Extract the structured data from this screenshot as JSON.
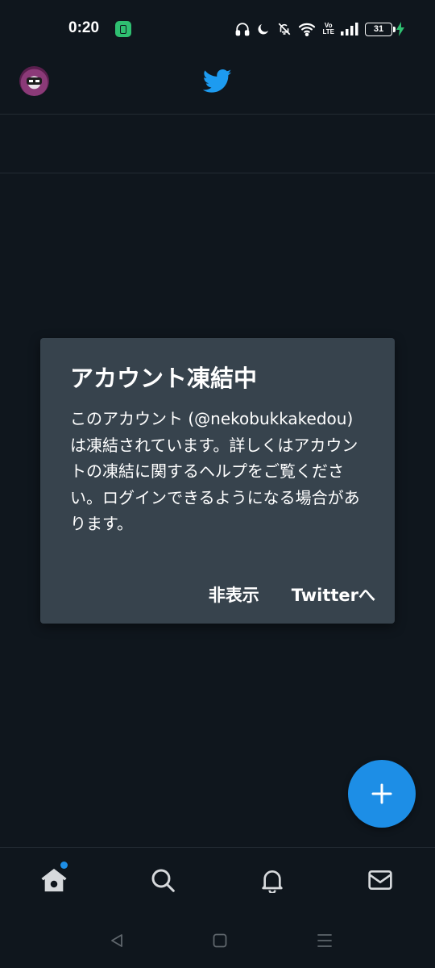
{
  "status_bar": {
    "time": "0:20",
    "volte_top": "Vo",
    "volte_bottom": "LTE",
    "battery_level": "31"
  },
  "header": {
    "logo": "twitter-bird-icon"
  },
  "dialog": {
    "title": "アカウント凍結中",
    "message": "このアカウント (@nekobukkakedou) は凍結されています。詳しくはアカウントの凍結に関するヘルプをご覧ください。ログインできるようになる場合があります。",
    "dismiss_label": "非表示",
    "goto_label": "Twitterへ"
  },
  "bottom_nav": {
    "items": [
      "home-icon",
      "search-icon",
      "notifications-icon",
      "messages-icon"
    ]
  },
  "colors": {
    "background": "#0f161d",
    "dialog": "#37434d",
    "accent": "#1d8ee6"
  }
}
